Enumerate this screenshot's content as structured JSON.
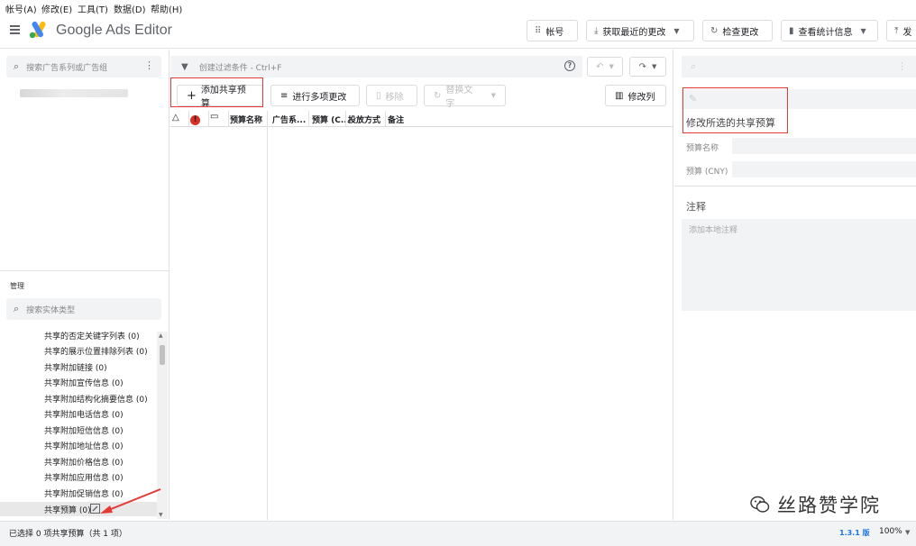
{
  "menu": [
    {
      "label": "帐号(A)"
    },
    {
      "label": "修改(E)"
    },
    {
      "label": "工具(T)"
    },
    {
      "label": "数据(D)"
    },
    {
      "label": "帮助(H)"
    }
  ],
  "header": {
    "brand": "Google Ads Editor",
    "buttons": {
      "accounts": "帐号",
      "get_changes": "获取最近的更改",
      "check_changes": "检查更改",
      "view_stats": "查看统计信息",
      "post": "发"
    }
  },
  "left_panel": {
    "search_placeholder": "搜索广告系列或广告组",
    "management_label": "管理",
    "entity_search_placeholder": "搜索实体类型",
    "tree_items": [
      "共享的否定关键字列表 (0)",
      "共享的展示位置排除列表 (0)",
      "共享附加链接 (0)",
      "共享附加宣传信息 (0)",
      "共享附加结构化摘要信息 (0)",
      "共享附加电话信息 (0)",
      "共享附加短信信息 (0)",
      "共享附加地址信息 (0)",
      "共享附加价格信息 (0)",
      "共享附加应用信息 (0)",
      "共享附加促销信息 (0)",
      "共享预算 (0)"
    ]
  },
  "center_panel": {
    "filter_placeholder": "创建过滤条件 - Ctrl+F",
    "toolbar": {
      "add_shared_budget": "添加共享预算",
      "bulk_changes": "进行多项更改",
      "remove": "移除",
      "replace_text": "替换文字",
      "modify_columns": "修改列"
    },
    "columns": [
      "预算名称",
      "广告系...",
      "预算 (C...",
      "投放方式",
      "备注"
    ]
  },
  "right_panel": {
    "edit_title": "修改所选的共享预算",
    "budget_name_label": "预算名称",
    "budget_amount_label": "预算 (CNY)",
    "notes_heading": "注释",
    "notes_placeholder": "添加本地注释"
  },
  "status_bar": {
    "selection_text": "已选择 0 项共享预算（共 1 项）",
    "version": "1.3.1 版",
    "zoom": "100%"
  },
  "watermark": {
    "text": "丝路赞学院"
  },
  "colors": {
    "highlight_red": "#e53935",
    "google_blue": "#4285f4",
    "google_yellow": "#fbbc04",
    "google_green": "#34a853",
    "error_red": "#d93025",
    "version_blue": "#1a73e8"
  }
}
